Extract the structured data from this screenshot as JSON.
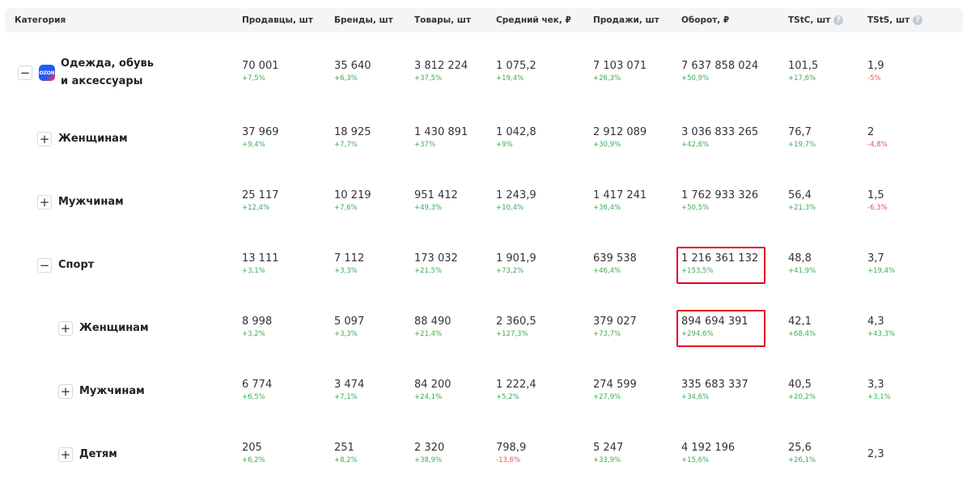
{
  "columns": [
    "Категория",
    "Продавцы, шт",
    "Бренды, шт",
    "Товары, шт",
    "Средний чек, ₽",
    "Продажи, шт",
    "Оборот, ₽",
    "TStC, шт",
    "TStS, шт"
  ],
  "info_icon_glyph": "?",
  "toggle_glyphs": {
    "expanded": "−",
    "collapsed": "+"
  },
  "logo_text": "OZON",
  "colors": {
    "positive": "#3fab54",
    "negative": "#e05353",
    "highlight": "#e60023",
    "brand_blue": "#1e5bff"
  },
  "rows": [
    {
      "level": 0,
      "expanded": true,
      "has_logo": true,
      "label": [
        "Одежда, обувь",
        "и аксессуары"
      ],
      "cells": [
        [
          "70 001",
          "+7,5%"
        ],
        [
          "35 640",
          "+6,3%"
        ],
        [
          "3 812 224",
          "+37,5%"
        ],
        [
          "1 075,2",
          "+19,4%"
        ],
        [
          "7 103 071",
          "+26,3%"
        ],
        [
          "7 637 858 024",
          "+50,9%"
        ],
        [
          "101,5",
          "+17,6%"
        ],
        [
          "1,9",
          "-5%"
        ]
      ]
    },
    {
      "level": 1,
      "expanded": false,
      "has_logo": false,
      "label": [
        "Женщинам"
      ],
      "cells": [
        [
          "37 969",
          "+9,4%"
        ],
        [
          "18 925",
          "+7,7%"
        ],
        [
          "1 430 891",
          "+37%"
        ],
        [
          "1 042,8",
          "+9%"
        ],
        [
          "2 912 089",
          "+30,9%"
        ],
        [
          "3 036 833 265",
          "+42,6%"
        ],
        [
          "76,7",
          "+19,7%"
        ],
        [
          "2",
          "-4,8%"
        ]
      ]
    },
    {
      "level": 1,
      "expanded": false,
      "has_logo": false,
      "label": [
        "Мужчинам"
      ],
      "cells": [
        [
          "25 117",
          "+12,4%"
        ],
        [
          "10 219",
          "+7,6%"
        ],
        [
          "951 412",
          "+49,3%"
        ],
        [
          "1 243,9",
          "+10,4%"
        ],
        [
          "1 417 241",
          "+36,4%"
        ],
        [
          "1 762 933 326",
          "+50,5%"
        ],
        [
          "56,4",
          "+21,3%"
        ],
        [
          "1,5",
          "-6,3%"
        ]
      ]
    },
    {
      "level": 1,
      "expanded": true,
      "has_logo": false,
      "label": [
        "Спорт"
      ],
      "highlight_col": 5,
      "cells": [
        [
          "13 111",
          "+3,1%"
        ],
        [
          "7 112",
          "+3,3%"
        ],
        [
          "173 032",
          "+21,5%"
        ],
        [
          "1 901,9",
          "+73,2%"
        ],
        [
          "639 538",
          "+46,4%"
        ],
        [
          "1 216 361 132",
          "+153,5%"
        ],
        [
          "48,8",
          "+41,9%"
        ],
        [
          "3,7",
          "+19,4%"
        ]
      ]
    },
    {
      "level": 2,
      "expanded": false,
      "has_logo": false,
      "label": [
        "Женщинам"
      ],
      "highlight_col": 5,
      "cells": [
        [
          "8 998",
          "+3,2%"
        ],
        [
          "5 097",
          "+3,3%"
        ],
        [
          "88 490",
          "+21,4%"
        ],
        [
          "2 360,5",
          "+127,3%"
        ],
        [
          "379 027",
          "+73,7%"
        ],
        [
          "894 694 391",
          "+294,6%"
        ],
        [
          "42,1",
          "+68,4%"
        ],
        [
          "4,3",
          "+43,3%"
        ]
      ]
    },
    {
      "level": 2,
      "expanded": false,
      "has_logo": false,
      "label": [
        "Мужчинам"
      ],
      "cells": [
        [
          "6 774",
          "+6,5%"
        ],
        [
          "3 474",
          "+7,1%"
        ],
        [
          "84 200",
          "+24,1%"
        ],
        [
          "1 222,4",
          "+5,2%"
        ],
        [
          "274 599",
          "+27,9%"
        ],
        [
          "335 683 337",
          "+34,6%"
        ],
        [
          "40,5",
          "+20,2%"
        ],
        [
          "3,3",
          "+3,1%"
        ]
      ]
    },
    {
      "level": 2,
      "expanded": false,
      "has_logo": false,
      "label": [
        "Детям"
      ],
      "cells": [
        [
          "205",
          "+6,2%"
        ],
        [
          "251",
          "+8,2%"
        ],
        [
          "2 320",
          "+38,9%"
        ],
        [
          "798,9",
          "-13,6%"
        ],
        [
          "5 247",
          "+33,9%"
        ],
        [
          "4 192 196",
          "+15,6%"
        ],
        [
          "25,6",
          "+26,1%"
        ],
        [
          "2,3",
          ""
        ]
      ]
    }
  ]
}
